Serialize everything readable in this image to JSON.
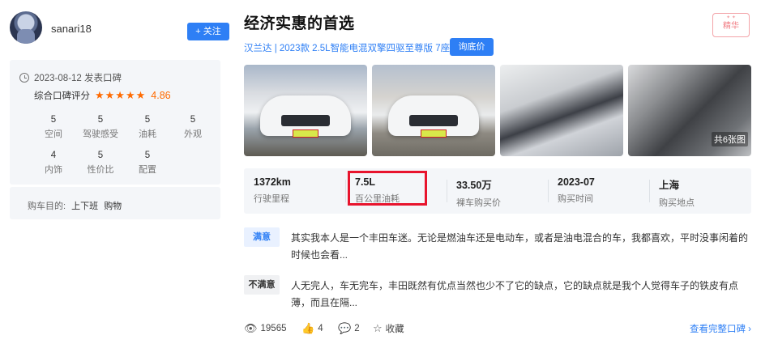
{
  "user": {
    "name": "sanari18",
    "follow_label": "+ 关注"
  },
  "review_info": {
    "date_text": "2023-08-12 发表口碑",
    "overall_label": "综合口碑评分",
    "overall_stars": "★★★★★",
    "overall_score": "4.86",
    "ratings": [
      {
        "score": "5",
        "label": "空间"
      },
      {
        "score": "5",
        "label": "驾驶感受"
      },
      {
        "score": "5",
        "label": "油耗"
      },
      {
        "score": "5",
        "label": "外观"
      },
      {
        "score": "4",
        "label": "内饰"
      },
      {
        "score": "5",
        "label": "性价比"
      },
      {
        "score": "5",
        "label": "配置"
      }
    ],
    "purpose_label": "购车目的:",
    "purposes": [
      "上下班",
      "购物"
    ]
  },
  "main": {
    "title": "经济实惠的首选",
    "badge": "精华",
    "model_text": "汉兰达 | 2023款 2.5L智能电混双擎四驱至尊版 7座",
    "price_button": "询底价",
    "photo_count": "共6张图",
    "specs": [
      {
        "value": "1372km",
        "label": "行驶里程"
      },
      {
        "value": "7.5L",
        "label": "百公里油耗"
      },
      {
        "value": "33.50万",
        "label": "裸车购买价"
      },
      {
        "value": "2023-07",
        "label": "购买时间"
      },
      {
        "value": "上海",
        "label": "购买地点"
      }
    ],
    "satisfied_tag": "满意",
    "satisfied_text": "其实我本人是一个丰田车迷。无论是燃油车还是电动车，或者是油电混合的车，我都喜欢，平时没事闲着的时候也会看...",
    "unsatisfied_tag": "不满意",
    "unsatisfied_text": "人无完人，车无完车，丰田既然有优点当然也少不了它的缺点，它的缺点就是我个人觉得车子的铁皮有点薄，而且在隔...",
    "views": "19565",
    "likes": "4",
    "comments": "2",
    "collect_label": "收藏",
    "more_link": "查看完整口碑 ›"
  },
  "colors": {
    "accent": "#2e7ff5",
    "star": "#ff6a00",
    "highlight_box": "#e8142d"
  }
}
